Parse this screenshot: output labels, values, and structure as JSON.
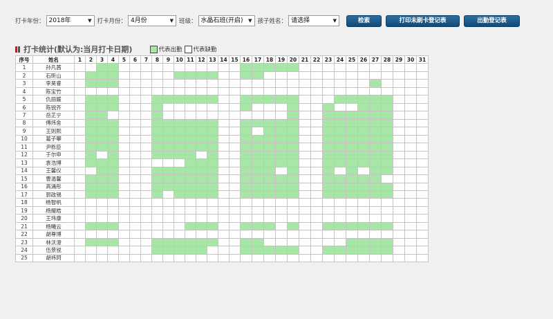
{
  "filters": {
    "year_label": "打卡年份：",
    "year_value": "2018年",
    "month_label": "打卡月份：",
    "month_value": "4月份",
    "class_label": "班级：",
    "class_value": "水晶石班(开启)",
    "child_label": "孩子姓名：",
    "child_value": "请选择"
  },
  "buttons": {
    "search": "检索",
    "print_unpunched": "打印未刷卡登记表",
    "attendance_register": "出勤登记表"
  },
  "section": {
    "title": "打卡统计(默认为:当月打卡日期)",
    "legend_present": "代表出勤",
    "legend_absent": "代表缺勤"
  },
  "colors": {
    "present": "#a8e6a8",
    "absent": "#ffffff",
    "marker_red": "#b22222",
    "marker_dark": "#555555",
    "button": "#1b5a8a"
  },
  "table": {
    "col_index": "序号",
    "col_name": "姓名",
    "days": [
      "1",
      "2",
      "3",
      "4",
      "5",
      "6",
      "7",
      "8",
      "9",
      "10",
      "11",
      "12",
      "13",
      "14",
      "15",
      "16",
      "17",
      "18",
      "19",
      "20",
      "21",
      "22",
      "23",
      "24",
      "25",
      "26",
      "27",
      "28",
      "29",
      "30",
      "31"
    ],
    "rows": [
      {
        "index": "1",
        "name": "孙凡茜",
        "present": [
          3,
          4,
          16,
          17,
          18,
          19,
          20
        ]
      },
      {
        "index": "2",
        "name": "石昕山",
        "present": [
          2,
          3,
          4,
          10,
          11,
          12,
          13,
          16,
          17
        ]
      },
      {
        "index": "3",
        "name": "李昊睿",
        "present": [
          2,
          3,
          4,
          27
        ]
      },
      {
        "index": "4",
        "name": "陈宝竹",
        "present": []
      },
      {
        "index": "5",
        "name": "仇丽媛",
        "present": [
          2,
          3,
          4,
          8,
          9,
          10,
          11,
          12,
          13,
          16,
          17,
          18,
          19,
          20,
          24,
          25,
          26,
          27,
          28
        ]
      },
      {
        "index": "6",
        "name": "陈锐齐",
        "present": [
          2,
          3,
          4,
          8,
          16,
          20,
          23,
          26,
          27,
          28
        ]
      },
      {
        "index": "7",
        "name": "岳芷宁",
        "present": [
          2,
          3,
          8,
          20,
          23,
          24,
          25,
          26,
          27,
          28
        ]
      },
      {
        "index": "8",
        "name": "傅炜舍",
        "present": [
          2,
          3,
          4,
          8,
          9,
          10,
          11,
          12,
          13,
          16,
          17,
          18,
          19,
          20,
          23,
          24,
          25,
          26,
          27,
          28
        ]
      },
      {
        "index": "9",
        "name": "王则熙",
        "present": [
          2,
          3,
          4,
          8,
          9,
          10,
          11,
          12,
          13,
          16,
          18,
          19,
          20,
          23,
          24,
          25,
          26,
          27,
          28
        ]
      },
      {
        "index": "10",
        "name": "葛子攀",
        "present": [
          2,
          3,
          4,
          8,
          9,
          10,
          11,
          12,
          13,
          16,
          17,
          18,
          19,
          20,
          23,
          24,
          25,
          26,
          27,
          28
        ]
      },
      {
        "index": "11",
        "name": "尹栎臣",
        "present": [
          2,
          3,
          4,
          8,
          9,
          10,
          11,
          12,
          13,
          16,
          17,
          18,
          19,
          20,
          23,
          24,
          25,
          26,
          27,
          28
        ]
      },
      {
        "index": "12",
        "name": "于尔申",
        "present": [
          2,
          4,
          8,
          9,
          10,
          11,
          13,
          16,
          17,
          18,
          19,
          20,
          23,
          24,
          25,
          26,
          27,
          28
        ]
      },
      {
        "index": "13",
        "name": "袁浩博",
        "present": [
          2,
          3,
          4,
          11,
          12,
          13,
          16,
          17,
          18,
          19,
          20,
          23,
          24,
          25,
          26,
          27,
          28
        ]
      },
      {
        "index": "14",
        "name": "王馨仪",
        "present": [
          3,
          4,
          8,
          9,
          10,
          11,
          12,
          13,
          16,
          17,
          18,
          20,
          23,
          25,
          27,
          28
        ]
      },
      {
        "index": "15",
        "name": "曹温馨",
        "present": [
          2,
          3,
          4,
          8,
          9,
          10,
          11,
          12,
          13,
          16,
          17,
          18,
          19,
          20,
          23,
          24,
          25,
          26,
          27
        ]
      },
      {
        "index": "16",
        "name": "高涌彤",
        "present": [
          2,
          3,
          4,
          8,
          9,
          10,
          11,
          12,
          13,
          16,
          17,
          18,
          19,
          20,
          23,
          24,
          25,
          26,
          27,
          28
        ]
      },
      {
        "index": "17",
        "name": "郭政锡",
        "present": [
          2,
          3,
          4,
          8,
          10,
          11,
          12,
          13,
          16,
          17,
          18,
          19,
          20,
          23,
          24,
          25,
          26,
          27,
          28
        ]
      },
      {
        "index": "18",
        "name": "杨智帆",
        "present": []
      },
      {
        "index": "19",
        "name": "杨耀皓",
        "present": []
      },
      {
        "index": "20",
        "name": "王玮康",
        "present": []
      },
      {
        "index": "21",
        "name": "杨曦云",
        "present": [
          2,
          3,
          4,
          11,
          12,
          13,
          16,
          17,
          18,
          20,
          23,
          24,
          25,
          26,
          27,
          28
        ]
      },
      {
        "index": "22",
        "name": "胡尊博",
        "present": []
      },
      {
        "index": "23",
        "name": "林沃澄",
        "present": [
          2,
          3,
          4,
          8,
          9,
          10,
          11,
          12,
          13,
          16,
          17,
          25,
          26,
          27,
          28
        ]
      },
      {
        "index": "24",
        "name": "伍景锐",
        "present": [
          8,
          9,
          10,
          11,
          12,
          16,
          17,
          18,
          19,
          20,
          23,
          24,
          25,
          26,
          27,
          28
        ]
      },
      {
        "index": "25",
        "name": "胡祎珂",
        "present": []
      }
    ]
  }
}
